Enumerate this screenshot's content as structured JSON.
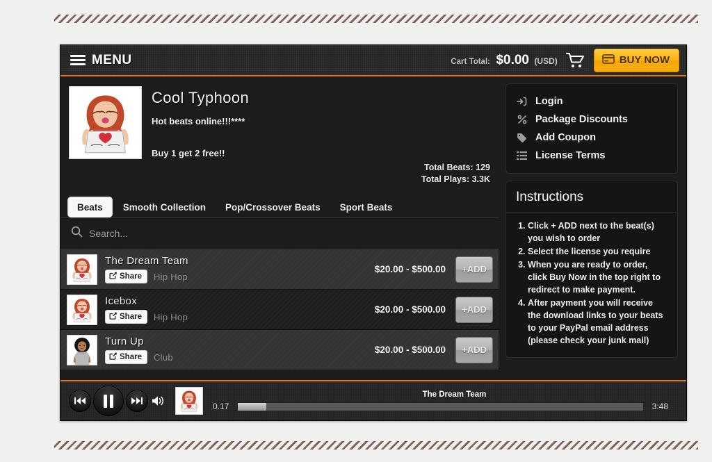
{
  "header": {
    "menu_label": "MENU",
    "menu_icon": "hamburger-icon",
    "cart_total_label": "Cart Total:",
    "cart_total_value": "$0.00",
    "cart_currency": "(USD)",
    "cart_icon": "shopping-cart-icon",
    "buy_now_label": "BUY NOW",
    "buy_now_icon": "credit-card-icon",
    "accent_color": "#e2761b",
    "buy_now_color": "#fcb315"
  },
  "profile": {
    "avatar_alt": "cool-typhoon-artist-avatar",
    "artist_name": "Cool Typhoon",
    "tagline": "Hot beats online!!!****",
    "promo": "Buy 1 get 2 free!!",
    "total_beats": "Total Beats: 129",
    "total_plays": "Total Plays: 3.3K"
  },
  "tabs": [
    {
      "label": "Beats",
      "active": true
    },
    {
      "label": "Smooth Collection",
      "active": false
    },
    {
      "label": "Pop/Crossover Beats",
      "active": false
    },
    {
      "label": "Sport Beats",
      "active": false
    }
  ],
  "search": {
    "placeholder": "Search...",
    "value": "",
    "icon": "search-icon"
  },
  "beats": [
    {
      "title": "The Dream Team",
      "genre": "Hip Hop",
      "price": "$20.00 - $500.00",
      "share_label": "Share",
      "add_label": "+ADD",
      "thumb": "red-hair-banner"
    },
    {
      "title": "Icebox",
      "genre": "Hip Hop",
      "price": "$20.00 - $500.00",
      "share_label": "Share",
      "add_label": "+ADD",
      "thumb": "red-hair-banner"
    },
    {
      "title": "Turn Up",
      "genre": "Club",
      "price": "$20.00 - $500.00",
      "share_label": "Share",
      "add_label": "+ADD",
      "thumb": "afro-girl"
    }
  ],
  "side_menu": [
    {
      "label": "Login",
      "icon": "sign-in-icon"
    },
    {
      "label": "Package Discounts",
      "icon": "percent-icon"
    },
    {
      "label": "Add Coupon",
      "icon": "tag-icon"
    },
    {
      "label": "License Terms",
      "icon": "list-icon"
    }
  ],
  "instructions": {
    "title": "Instructions",
    "steps": [
      "Click + ADD next to the beat(s) you wish to order",
      "Select the license you require",
      "When you are ready to order, click Buy Now in the top right to redirect to make payment.",
      "After payment you will receive the download links to your beats to your PayPal email address (please check your junk mail)"
    ]
  },
  "player": {
    "prev_icon": "previous-track-icon",
    "play_pause_icon": "pause-icon",
    "next_icon": "next-track-icon",
    "volume_icon": "volume-icon",
    "now_playing": "The Dream Team",
    "current_time": "0.17",
    "duration": "3:48",
    "progress_percent": 7,
    "thumb": "red-hair-banner"
  }
}
